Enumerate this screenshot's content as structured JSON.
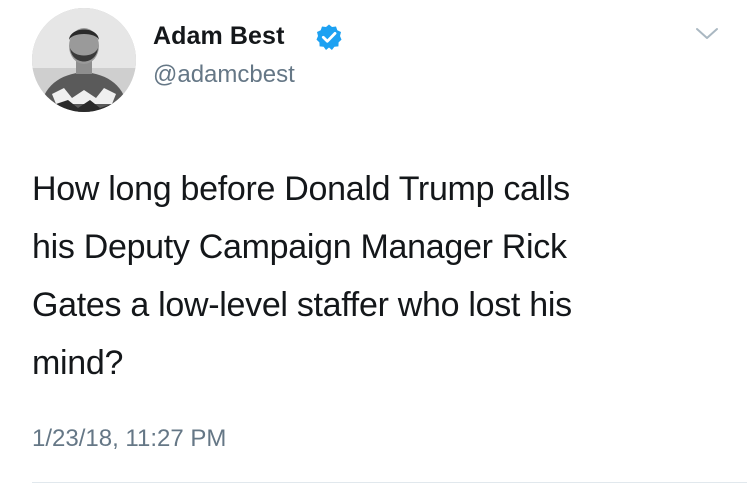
{
  "author": {
    "display_name": "Adam Best",
    "handle": "@adamcbest",
    "verified": true
  },
  "tweet": {
    "text": "How long before Donald Trump calls\nhis Deputy Campaign Manager Rick\nGates a low-level staffer who lost his\nmind?",
    "timestamp": "1/23/18, 11:27 PM"
  },
  "icons": {
    "verified": "verified-badge-icon",
    "menu": "chevron-down-icon"
  },
  "colors": {
    "verified_blue": "#1da1f2",
    "secondary_text": "#657786",
    "primary_text": "#14171a"
  }
}
